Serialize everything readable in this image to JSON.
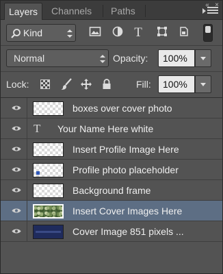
{
  "tabs": [
    {
      "label": "Layers",
      "active": true
    },
    {
      "label": "Channels",
      "active": false
    },
    {
      "label": "Paths",
      "active": false
    }
  ],
  "window_controls": {
    "collapse": "«",
    "close": "×"
  },
  "filter": {
    "kind_label": "Kind",
    "icons": [
      "image-filter-icon",
      "adjustment-filter-icon",
      "type-filter-icon",
      "shape-filter-icon",
      "smart-object-filter-icon"
    ],
    "type_glyph": "T"
  },
  "blend": {
    "mode": "Normal",
    "opacity_label": "Opacity:",
    "opacity_value": "100%",
    "fill_label": "Fill:",
    "fill_value": "100%"
  },
  "lock": {
    "label": "Lock:"
  },
  "layers": [
    {
      "name": "boxes over cover photo",
      "thumb": "transparent",
      "visible": true,
      "selected": false
    },
    {
      "name": "Your Name Here white",
      "thumb": "type",
      "glyph": "T",
      "visible": true,
      "selected": false
    },
    {
      "name": "Insert Profile Image Here",
      "thumb": "transparent",
      "visible": true,
      "selected": false
    },
    {
      "name": "Profile photo placeholder",
      "thumb": "transparent-dot",
      "visible": true,
      "selected": false
    },
    {
      "name": "Background frame",
      "thumb": "transparent",
      "visible": true,
      "selected": false
    },
    {
      "name": "Insert Cover Images Here",
      "thumb": "cover",
      "visible": true,
      "selected": true
    },
    {
      "name": "Cover Image 851 pixels ...",
      "thumb": "navy",
      "visible": true,
      "selected": false
    }
  ],
  "colors": {
    "panel_bg": "#535353",
    "tabbar_bg": "#3c3c3c",
    "selected_row": "#5d6e84",
    "field_bg": "#e9e9e9"
  }
}
